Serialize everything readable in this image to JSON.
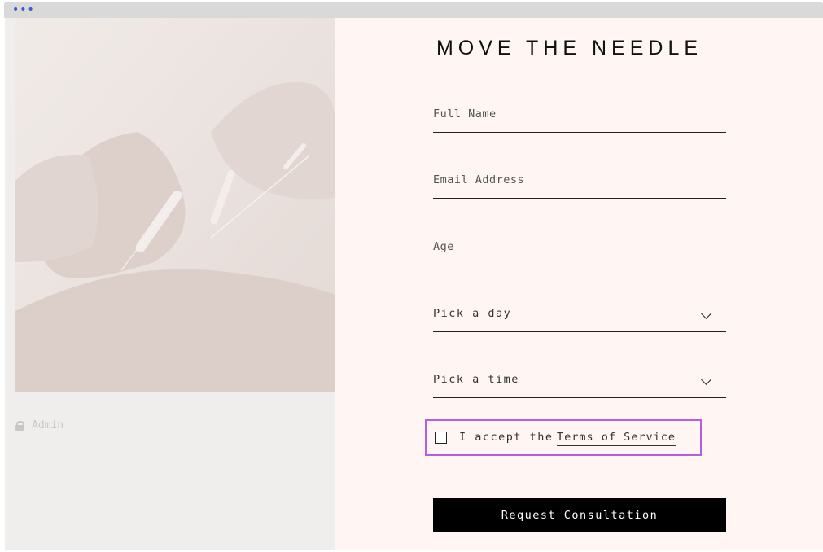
{
  "window": {
    "menu_dots": "•••"
  },
  "sidebar": {
    "admin_label": "Admin",
    "lock_icon": "lock-icon"
  },
  "form": {
    "title": "MOVE THE NEEDLE",
    "full_name_placeholder": "Full Name",
    "email_placeholder": "Email Address",
    "age_placeholder": "Age",
    "day_select_value": "Pick a day",
    "time_select_value": "Pick a time",
    "terms_prefix": "I accept the",
    "terms_link": "Terms of Service",
    "submit_label": "Request Consultation"
  },
  "colors": {
    "form_bg": "#fff5f2",
    "focus_outline": "#b85de0",
    "button_bg": "#000000"
  }
}
